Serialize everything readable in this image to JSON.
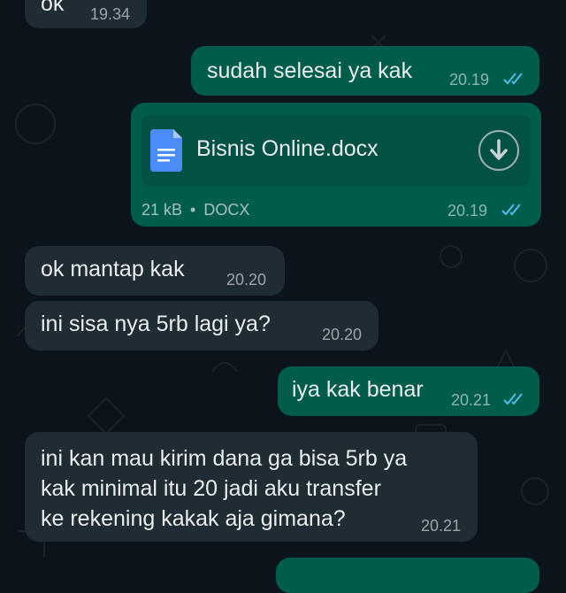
{
  "colors": {
    "background": "#0b141a",
    "incoming_bubble": "#202c33",
    "outgoing_bubble": "#005c4b",
    "read_ticks": "#53bdeb"
  },
  "messages": [
    {
      "dir": "in",
      "text": "ok",
      "time": "19.34"
    },
    {
      "dir": "out",
      "text": "sudah selesai ya kak",
      "time": "20.19",
      "status": "read"
    },
    {
      "dir": "out",
      "type": "document",
      "file_name": "Bisnis Online.docx",
      "file_size": "21 kB",
      "file_type": "DOCX",
      "separator": "•",
      "file_icon": "document-icon",
      "action_icon": "download-icon",
      "time": "20.19",
      "status": "read"
    },
    {
      "dir": "in",
      "text": "ok mantap kak",
      "time": "20.20"
    },
    {
      "dir": "in",
      "text": "ini sisa nya 5rb lagi ya?",
      "time": "20.20"
    },
    {
      "dir": "out",
      "text": "iya kak benar",
      "time": "20.21",
      "status": "read"
    },
    {
      "dir": "in",
      "lines": [
        "ini kan mau kirim dana ga bisa 5rb ya",
        "kak minimal itu 20 jadi aku transfer",
        "ke rekening kakak aja gimana?"
      ],
      "time": "20.21"
    }
  ]
}
